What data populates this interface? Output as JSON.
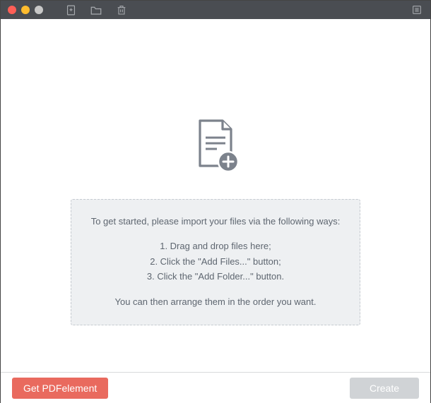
{
  "titlebar": {
    "icons": {
      "add_file": "add-file-icon",
      "folder": "folder-icon",
      "trash": "trash-icon",
      "list": "list-icon"
    }
  },
  "instructions": {
    "intro": "To get started, please import your files via the following ways:",
    "step1": "1. Drag and drop files here;",
    "step2": "2. Click the \"Add Files...\" button;",
    "step3": "3. Click the \"Add Folder...\" button.",
    "outro": "You can then arrange them in the order you want."
  },
  "footer": {
    "get_pdfelement_label": "Get PDFelement",
    "create_label": "Create"
  }
}
